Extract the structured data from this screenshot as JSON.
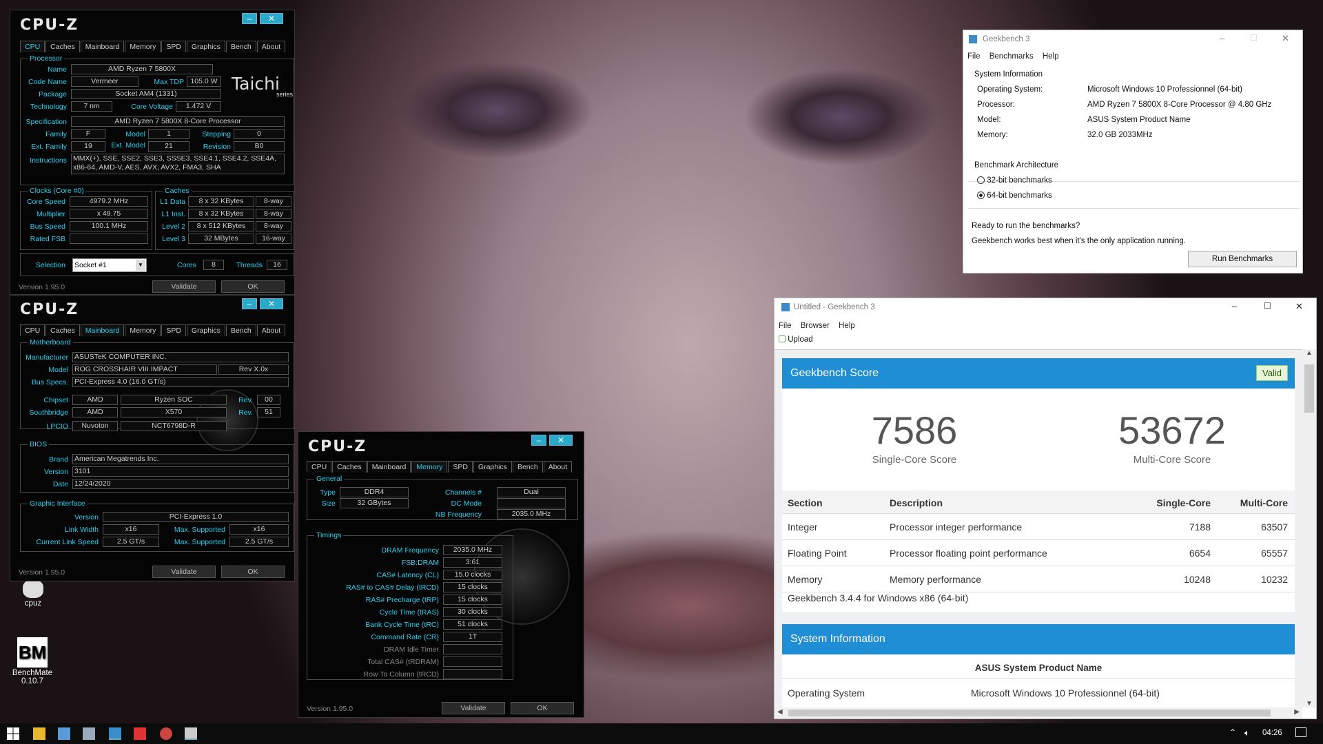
{
  "cpuz1": {
    "logo": "CPU-Z",
    "tabs": [
      "CPU",
      "Caches",
      "Mainboard",
      "Memory",
      "SPD",
      "Graphics",
      "Bench",
      "About"
    ],
    "processor_title": "Processor",
    "name_l": "Name",
    "name": "AMD Ryzen 7 5800X",
    "codename_l": "Code Name",
    "codename": "Vermeer",
    "maxtdp_l": "Max TDP",
    "maxtdp": "105.0 W",
    "package_l": "Package",
    "package": "Socket AM4 (1331)",
    "tech_l": "Technology",
    "tech": "7 nm",
    "corev_l": "Core Voltage",
    "corev": "1.472 V",
    "spec_l": "Specification",
    "spec": "AMD Ryzen 7 5800X 8-Core Processor",
    "family_l": "Family",
    "family": "F",
    "model_l": "Model",
    "model": "1",
    "stepping_l": "Stepping",
    "stepping": "0",
    "extfam_l": "Ext. Family",
    "extfam": "19",
    "extmodel_l": "Ext. Model",
    "extmodel": "21",
    "rev_l": "Revision",
    "rev": "B0",
    "instr_l": "Instructions",
    "instr1": "MMX(+), SSE, SSE2, SSE3, SSSE3, SSE4.1, SSE4.2, SSE4A,",
    "instr2": "x86-64, AMD-V, AES, AVX, AVX2, FMA3, SHA",
    "clocks_title": "Clocks (Core #0)",
    "corespeed_l": "Core Speed",
    "corespeed": "4979.2 MHz",
    "mult_l": "Multiplier",
    "mult": "x 49.75",
    "bus_l": "Bus Speed",
    "bus": "100.1 MHz",
    "fsb_l": "Rated FSB",
    "fsb": "",
    "caches_title": "Caches",
    "l1d_l": "L1 Data",
    "l1d": "8 x 32 KBytes",
    "l1d_w": "8-way",
    "l1i_l": "L1 Inst.",
    "l1i": "8 x 32 KBytes",
    "l1i_w": "8-way",
    "l2_l": "Level 2",
    "l2": "8 x 512 KBytes",
    "l2_w": "8-way",
    "l3_l": "Level 3",
    "l3": "32 MBytes",
    "l3_w": "16-way",
    "sel_l": "Selection",
    "sel": "Socket #1",
    "cores_l": "Cores",
    "cores": "8",
    "threads_l": "Threads",
    "threads": "16",
    "version": "Version 1.95.0",
    "validate": "Validate",
    "ok": "OK",
    "brand1": "Taichi",
    "brand2": "series"
  },
  "cpuz2": {
    "logo": "CPU-Z",
    "mb_title": "Motherboard",
    "manu_l": "Manufacturer",
    "manu": "ASUSTeK COMPUTER INC.",
    "model_l": "Model",
    "model": "ROG CROSSHAIR VIII IMPACT",
    "modelrev": "Rev X.0x",
    "busspec_l": "Bus Specs.",
    "busspec": "PCI-Express 4.0 (16.0 GT/s)",
    "chipset_l": "Chipset",
    "chipset1": "AMD",
    "chipset2": "Ryzen SOC",
    "chipsetrev_l": "Rev.",
    "chipsetrev": "00",
    "south_l": "Southbridge",
    "south1": "AMD",
    "south2": "X570",
    "southrev_l": "Rev.",
    "southrev": "51",
    "lpcio_l": "LPCIO",
    "lpcio1": "Nuvoton",
    "lpcio2": "NCT6798D-R",
    "bios_title": "BIOS",
    "brand_l": "Brand",
    "brand": "American Megatrends Inc.",
    "ver_l": "Version",
    "ver": "3101",
    "date_l": "Date",
    "date": "12/24/2020",
    "gi_title": "Graphic Interface",
    "giver_l": "Version",
    "giver": "PCI-Express 1.0",
    "lw_l": "Link Width",
    "lw": "x16",
    "maxs_l": "Max. Supported",
    "lwmax": "x16",
    "cls_l": "Current Link Speed",
    "cls": "2.5 GT/s",
    "clsmax": "2.5 GT/s",
    "version": "Version 1.95.0",
    "validate": "Validate",
    "ok": "OK"
  },
  "cpuz3": {
    "logo": "CPU-Z",
    "general_title": "General",
    "type_l": "Type",
    "type": "DDR4",
    "channels_l": "Channels #",
    "channels": "Dual",
    "size_l": "Size",
    "size": "32 GBytes",
    "dcmode_l": "DC Mode",
    "dcmode": "",
    "nbfreq_l": "NB Frequency",
    "nbfreq": "2035.0 MHz",
    "timings_title": "Timings",
    "timings": [
      {
        "l": "DRAM Frequency",
        "v": "2035.0 MHz",
        "grey": false
      },
      {
        "l": "FSB:DRAM",
        "v": "3:61",
        "grey": false
      },
      {
        "l": "CAS# Latency (CL)",
        "v": "15.0 clocks",
        "grey": false
      },
      {
        "l": "RAS# to CAS# Delay (tRCD)",
        "v": "15 clocks",
        "grey": false
      },
      {
        "l": "RAS# Precharge (tRP)",
        "v": "15 clocks",
        "grey": false
      },
      {
        "l": "Cycle Time (tRAS)",
        "v": "30 clocks",
        "grey": false
      },
      {
        "l": "Bank Cycle Time (tRC)",
        "v": "51 clocks",
        "grey": false
      },
      {
        "l": "Command Rate (CR)",
        "v": "1T",
        "grey": false
      },
      {
        "l": "DRAM Idle Timer",
        "v": "",
        "grey": true
      },
      {
        "l": "Total CAS# (tRDRAM)",
        "v": "",
        "grey": true
      },
      {
        "l": "Row To Column (tRCD)",
        "v": "",
        "grey": true
      }
    ],
    "version": "Version 1.95.0",
    "validate": "Validate",
    "ok": "OK"
  },
  "gb3": {
    "title": "Geekbench 3",
    "menu": [
      "File",
      "Benchmarks",
      "Help"
    ],
    "sysinfo_title": "System Information",
    "os_l": "Operating System:",
    "os": "Microsoft Windows 10 Professionnel (64-bit)",
    "proc_l": "Processor:",
    "proc": "AMD Ryzen 7 5800X 8-Core Processor @ 4.80 GHz",
    "model_l": "Model:",
    "model": "ASUS System Product Name",
    "mem_l": "Memory:",
    "mem": "32.0 GB  2033MHz",
    "arch_title": "Benchmark Architecture",
    "opt32": "32-bit benchmarks",
    "opt64": "64-bit benchmarks",
    "ready": "Ready to run the benchmarks?",
    "hint": "Geekbench works best when it's the only application running.",
    "run": "Run Benchmarks"
  },
  "gbr": {
    "title": "Untitled - Geekbench 3",
    "menu": [
      "File",
      "Browser",
      "Help"
    ],
    "upload": "Upload",
    "score_title": "Geekbench Score",
    "valid": "Valid",
    "single": "7586",
    "single_l": "Single-Core Score",
    "multi": "53672",
    "multi_l": "Multi-Core Score",
    "cols": [
      "Section",
      "Description",
      "Single-Core",
      "Multi-Core"
    ],
    "rows": [
      {
        "s": "Integer",
        "d": "Processor integer performance",
        "sc": "7188",
        "mc": "63507"
      },
      {
        "s": "Floating Point",
        "d": "Processor floating point performance",
        "sc": "6654",
        "mc": "65557"
      },
      {
        "s": "Memory",
        "d": "Memory performance",
        "sc": "10248",
        "mc": "10232"
      }
    ],
    "footer": "Geekbench 3.4.4 for Windows x86 (64-bit)",
    "sysinfo": "System Information",
    "sysname": "ASUS System Product Name",
    "os_l": "Operating System",
    "os": "Microsoft Windows 10 Professionnel (64-bit)"
  },
  "desktop": {
    "cpuz": "cpuz",
    "benchmate1": "BenchMate",
    "benchmate2": "0.10.7"
  },
  "taskbar": {
    "time": "04:26"
  }
}
